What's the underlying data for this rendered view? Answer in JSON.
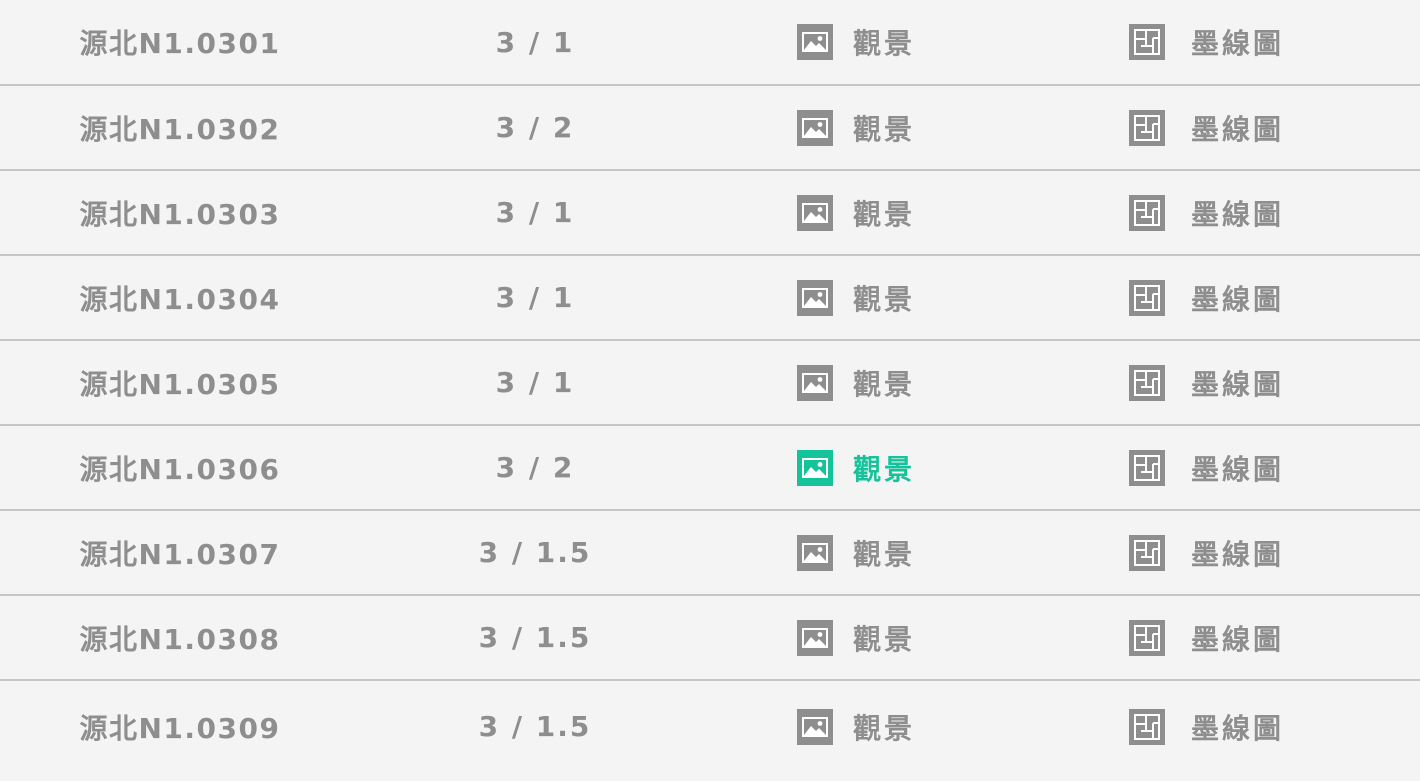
{
  "colors": {
    "text": "#8e8e8e",
    "accent": "#15c39a",
    "background": "#f4f4f4",
    "divider": "#c6c6c6"
  },
  "icons": {
    "view": "image-icon",
    "plan": "floorplan-icon"
  },
  "rows": [
    {
      "name": "源北N1.0301",
      "ratio": "3 / 1",
      "view_label": "觀景",
      "plan_label": "墨線圖",
      "active": false
    },
    {
      "name": "源北N1.0302",
      "ratio": "3 / 2",
      "view_label": "觀景",
      "plan_label": "墨線圖",
      "active": false
    },
    {
      "name": "源北N1.0303",
      "ratio": "3 / 1",
      "view_label": "觀景",
      "plan_label": "墨線圖",
      "active": false
    },
    {
      "name": "源北N1.0304",
      "ratio": "3 / 1",
      "view_label": "觀景",
      "plan_label": "墨線圖",
      "active": false
    },
    {
      "name": "源北N1.0305",
      "ratio": "3 / 1",
      "view_label": "觀景",
      "plan_label": "墨線圖",
      "active": false
    },
    {
      "name": "源北N1.0306",
      "ratio": "3 / 2",
      "view_label": "觀景",
      "plan_label": "墨線圖",
      "active": true
    },
    {
      "name": "源北N1.0307",
      "ratio": "3 / 1.5",
      "view_label": "觀景",
      "plan_label": "墨線圖",
      "active": false
    },
    {
      "name": "源北N1.0308",
      "ratio": "3 / 1.5",
      "view_label": "觀景",
      "plan_label": "墨線圖",
      "active": false
    },
    {
      "name": "源北N1.0309",
      "ratio": "3 / 1.5",
      "view_label": "觀景",
      "plan_label": "墨線圖",
      "active": false
    }
  ]
}
